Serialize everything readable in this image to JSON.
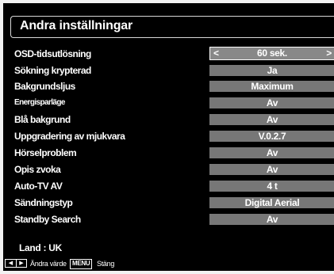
{
  "menu": {
    "title": "Andra inställningar",
    "rows": [
      {
        "label": "OSD-tidsutlösning",
        "value": "60 sek.",
        "selected": true,
        "arrow_left": "<",
        "arrow_right": ">"
      },
      {
        "label": "Sökning krypterad",
        "value": "Ja"
      },
      {
        "label": "Bakgrundsljus",
        "value": "Maximum"
      },
      {
        "label": "Energisparläge",
        "value": "Av"
      },
      {
        "label": "Blå bakgrund",
        "value": "Av"
      },
      {
        "label": "Uppgradering av mjukvara",
        "value": "V.0.2.7"
      },
      {
        "label": "Hörselproblem",
        "value": "Av"
      },
      {
        "label": "Opis zvoka",
        "value": "Av"
      },
      {
        "label": "Auto-TV AV",
        "value": "4 t"
      },
      {
        "label": "Sändningstyp",
        "value": "Digital Aerial"
      },
      {
        "label": "Standby Search",
        "value": "Av"
      }
    ],
    "land": "Land : UK"
  },
  "footer": {
    "arrow_left_glyph": "◀",
    "arrow_right_glyph": "▶",
    "hint_change": "Ändra värde",
    "menu_key": "MENU",
    "hint_close": "Stäng"
  },
  "colors": {
    "background": "#000000",
    "value_box": "#777777",
    "text": "#ffffff"
  }
}
